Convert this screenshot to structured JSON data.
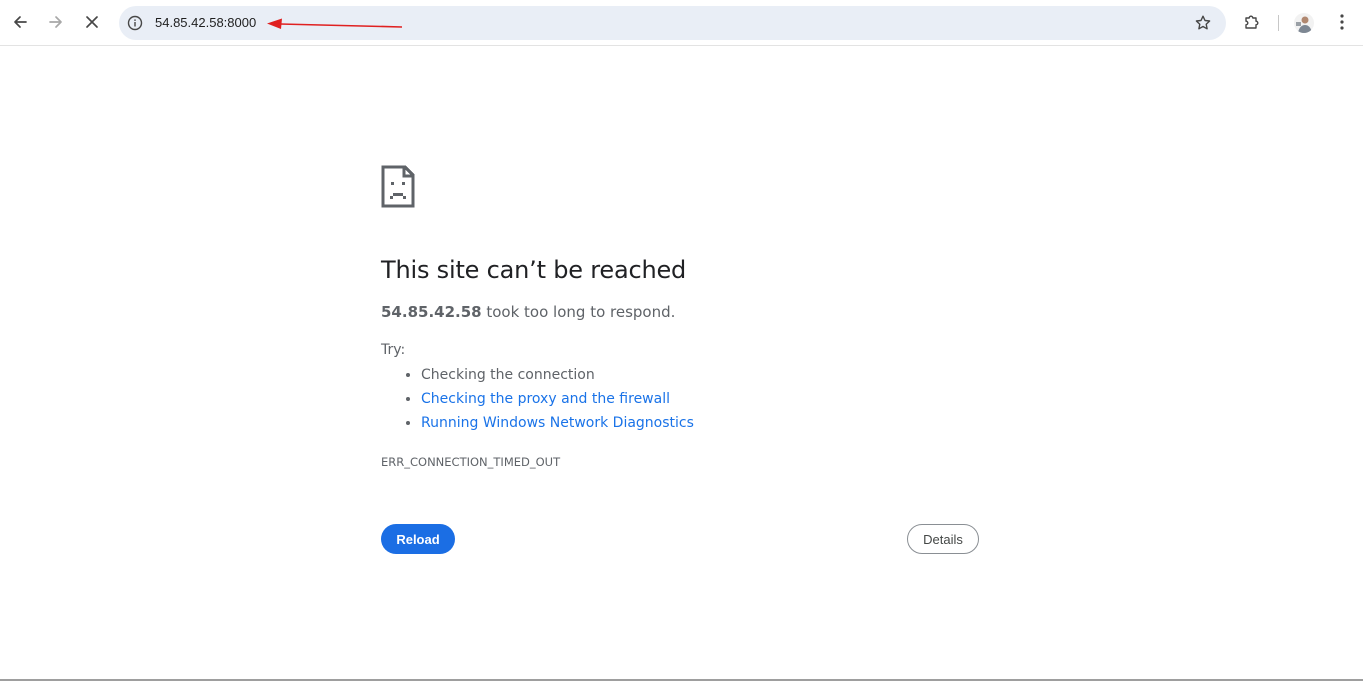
{
  "browser": {
    "url": "54.85.42.58:8000",
    "icons": {
      "back": "back-arrow-icon",
      "forward": "forward-arrow-icon",
      "stop": "stop-loading-icon",
      "site_info": "site-info-icon",
      "bookmark": "star-icon",
      "extensions": "puzzle-piece-icon",
      "menu": "three-dot-menu-icon"
    }
  },
  "annotation": {
    "arrow_color": "#e02020"
  },
  "error_page": {
    "heading": "This site can’t be reached",
    "host": "54.85.42.58",
    "summary_rest": " took too long to respond.",
    "try_label": "Try:",
    "suggestions": [
      "Checking the connection",
      "Checking the proxy and the firewall",
      "Running Windows Network Diagnostics"
    ],
    "error_code": "ERR_CONNECTION_TIMED_OUT",
    "reload_label": "Reload",
    "details_label": "Details"
  },
  "colors": {
    "accent": "#1b6ee4",
    "link": "#1a73e8",
    "text": "#5f6368",
    "heading": "#202124",
    "omnibox_bg": "#e9eef6"
  }
}
